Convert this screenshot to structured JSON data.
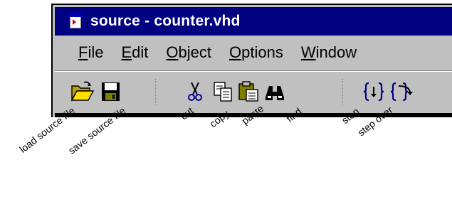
{
  "window": {
    "title": "source - counter.vhd"
  },
  "menu": [
    {
      "mnemonic": "F",
      "rest": "ile"
    },
    {
      "mnemonic": "E",
      "rest": "dit"
    },
    {
      "mnemonic": "O",
      "rest": "bject"
    },
    {
      "mnemonic": "O",
      "rest": "ptions"
    },
    {
      "mnemonic": "W",
      "rest": "indow"
    }
  ],
  "toolbar": {
    "buttons": [
      "folder-open-icon",
      "floppy-disk-icon",
      "scissors-icon",
      "copy-icon",
      "paste-icon",
      "binoculars-icon",
      "step-icon",
      "step-over-icon"
    ]
  },
  "labels": {
    "load": "load source file",
    "save": "save source file",
    "cut": "cut",
    "copy": "copy",
    "paste": "paste",
    "find": "find",
    "step": "step",
    "step_over": "step over"
  }
}
